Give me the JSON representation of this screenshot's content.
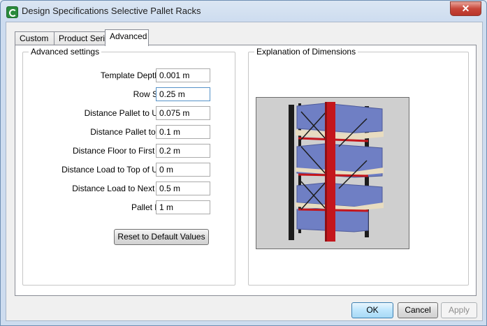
{
  "window": {
    "title": "Design Specifications Selective Pallet Racks",
    "close_glyph": "✕"
  },
  "tabs": [
    {
      "label": "Custom",
      "active": false
    },
    {
      "label": "Product Series",
      "active": false
    },
    {
      "label": "Advanced",
      "active": true
    }
  ],
  "advanced_settings": {
    "legend": "Advanced settings",
    "fields": [
      {
        "label": "Template Depth Step",
        "value": "0.001 m"
      },
      {
        "label": "Row Spacer",
        "value": "0.25 m"
      },
      {
        "label": "Distance Pallet to Upright",
        "value": "0.075 m"
      },
      {
        "label": "Distance Pallet to Pallet",
        "value": "0.1 m"
      },
      {
        "label": "Distance Floor to First Beam",
        "value": "0.2 m"
      },
      {
        "label": "Distance Load to Top of Upright",
        "value": "0 m"
      },
      {
        "label": "Distance Load to Next Beam",
        "value": "0.5 m"
      },
      {
        "label": "Pallet Height",
        "value": "1 m"
      }
    ],
    "reset_label": "Reset to Default Values"
  },
  "explanation": {
    "legend": "Explanation of Dimensions"
  },
  "footer": {
    "ok_label": "OK",
    "cancel_label": "Cancel",
    "apply_label": "Apply"
  },
  "colors": {
    "upright_red": "#c4161c",
    "frame_black": "#1c1c1c",
    "pallet_load_blue": "#6f7fc4",
    "pallet_wood": "#e8dcc0",
    "image_bg": "#cfcfcf"
  }
}
